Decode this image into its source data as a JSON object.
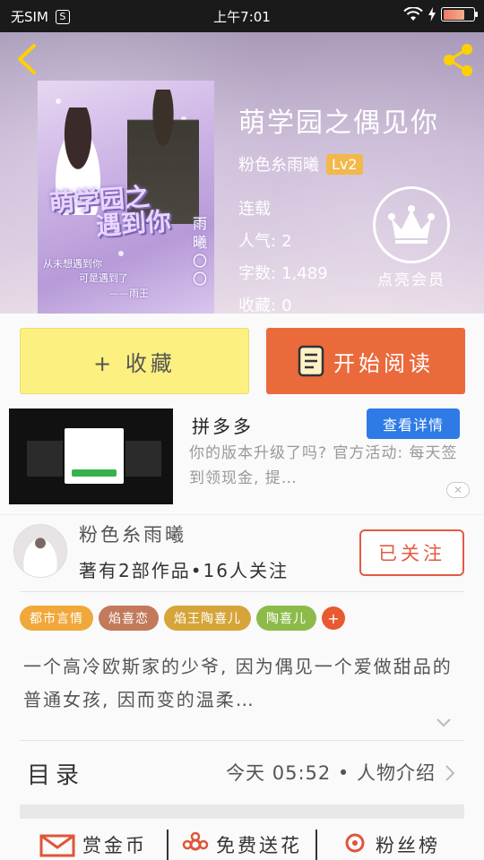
{
  "status_bar": {
    "carrier": "无SIM",
    "s_badge": "S",
    "time": "上午7:01"
  },
  "header": {
    "back_icon": "chevron-left-icon",
    "share_icon": "share-icon"
  },
  "cover": {
    "art_title_line1": "萌学园之",
    "art_title_line2": "遇到你",
    "side_text": "雨曦〇〇",
    "bottom_line1": "从未想遇到你",
    "bottom_line2": "可是遇到了",
    "bottom_line3": "——雨王"
  },
  "book": {
    "title": "萌学园之偶见你",
    "author": "粉色糸雨曦",
    "level": "Lv2",
    "status": "连载",
    "popularity_label": "人气:",
    "popularity": "2",
    "words_label": "字数:",
    "words": "1,489",
    "favorites_label": "收藏:",
    "favorites": "0"
  },
  "vip": {
    "icon": "crown-icon",
    "label": "点亮会员"
  },
  "actions": {
    "collect": "+ 收藏",
    "read": "开始阅读",
    "read_icon": "book-icon"
  },
  "ad": {
    "title": "拼多多",
    "details_button": "查看详情",
    "description": "你的版本升级了吗? 官方活动: 每天签到领现金, 提…",
    "close": "✕"
  },
  "author_card": {
    "name": "粉色糸雨曦",
    "stats": "著有2部作品•16人关注",
    "follow_button": "已关注"
  },
  "tags": [
    {
      "label": "都市言情",
      "color": "#f0a83a"
    },
    {
      "label": "焰喜恋",
      "color": "#c27a5a"
    },
    {
      "label": "焰王陶喜儿",
      "color": "#d6a53a"
    },
    {
      "label": "陶喜儿",
      "color": "#8cbb4a"
    }
  ],
  "tag_add": "+",
  "synopsis": "一个高冷欧斯家的少爷, 因为偶见一个爱做甜品的普通女孩, 因而变的温柔…",
  "toc": {
    "title": "目录",
    "latest": "今天 05:52 • 人物介绍"
  },
  "bottom_actions": [
    {
      "label": "赏金币",
      "icon": "envelope-icon"
    },
    {
      "label": "免费送花",
      "icon": "flower-icon"
    },
    {
      "label": "粉丝榜",
      "icon": "ribbon-icon"
    }
  ]
}
